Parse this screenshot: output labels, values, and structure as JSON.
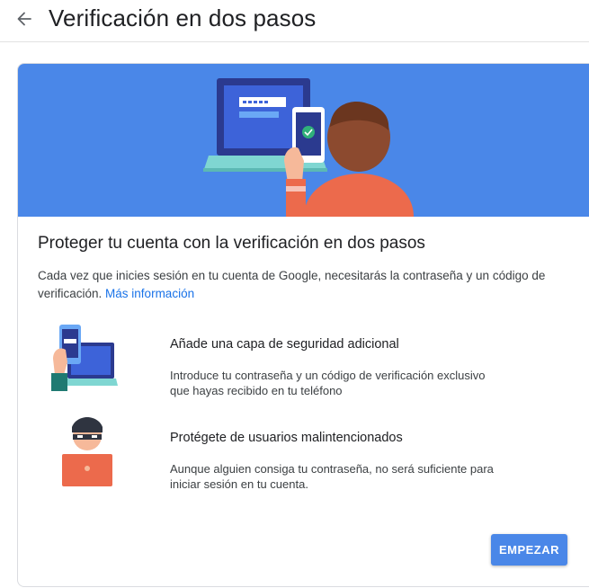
{
  "header": {
    "title": "Verificación en dos pasos"
  },
  "card": {
    "title": "Proteger tu cuenta con la verificación en dos pasos",
    "description": "Cada vez que inicies sesión en tu cuenta de Google, necesitarás la contraseña y un código de verificación.",
    "more_link": "Más información",
    "features": [
      {
        "title": "Añade una capa de seguridad adicional",
        "text": "Introduce tu contraseña y un código de verificación exclusivo que hayas recibido en tu teléfono",
        "icon": "phone-laptop-icon"
      },
      {
        "title": "Protégete de usuarios malintencionados",
        "text": "Aunque alguien consiga tu contraseña, no será suficiente para iniciar sesión en tu cuenta.",
        "icon": "masked-user-icon"
      }
    ],
    "start_button": "EMPEZAR"
  },
  "colors": {
    "accent": "#4a87e8",
    "link": "#1a73e8",
    "title": "#202124"
  }
}
